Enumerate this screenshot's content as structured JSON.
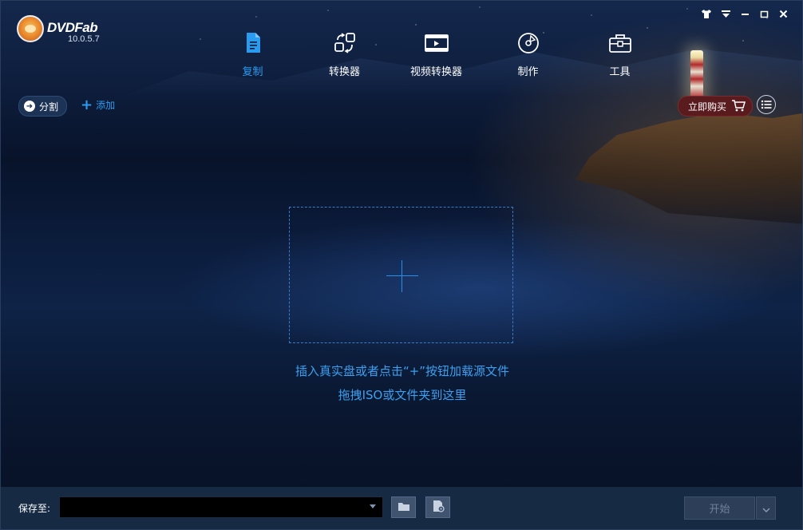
{
  "app": {
    "name": "DVDFab",
    "version": "10.0.5.7"
  },
  "window_controls": [
    {
      "name": "skin-icon",
      "glyph": "👕"
    },
    {
      "name": "dropdown-icon",
      "glyph": "▼"
    },
    {
      "name": "minimize-icon",
      "glyph": "—"
    },
    {
      "name": "maximize-icon",
      "glyph": "□"
    },
    {
      "name": "close-icon",
      "glyph": "✕"
    }
  ],
  "nav": {
    "items": [
      {
        "label": "复制",
        "icon": "copy-document-icon",
        "active": true
      },
      {
        "label": "转换器",
        "icon": "converter-icon",
        "active": false
      },
      {
        "label": "视频转换器",
        "icon": "video-converter-icon",
        "active": false
      },
      {
        "label": "制作",
        "icon": "disc-creator-icon",
        "active": false
      },
      {
        "label": "工具",
        "icon": "toolbox-icon",
        "active": false
      }
    ]
  },
  "actions": {
    "split_label": "分割",
    "add_label": "添加",
    "buy_label": "立即购买"
  },
  "drop_zone": {
    "hint_line1": "插入真实盘或者点击“+”按钮加载源文件",
    "hint_line2": "拖拽ISO或文件夹到这里"
  },
  "bottom": {
    "save_label": "保存至:",
    "save_path": "",
    "start_label": "开始"
  },
  "colors": {
    "accent": "#2b9bf0",
    "bottom_bar": "#162a44",
    "buy_button": "#5a1b1f"
  }
}
